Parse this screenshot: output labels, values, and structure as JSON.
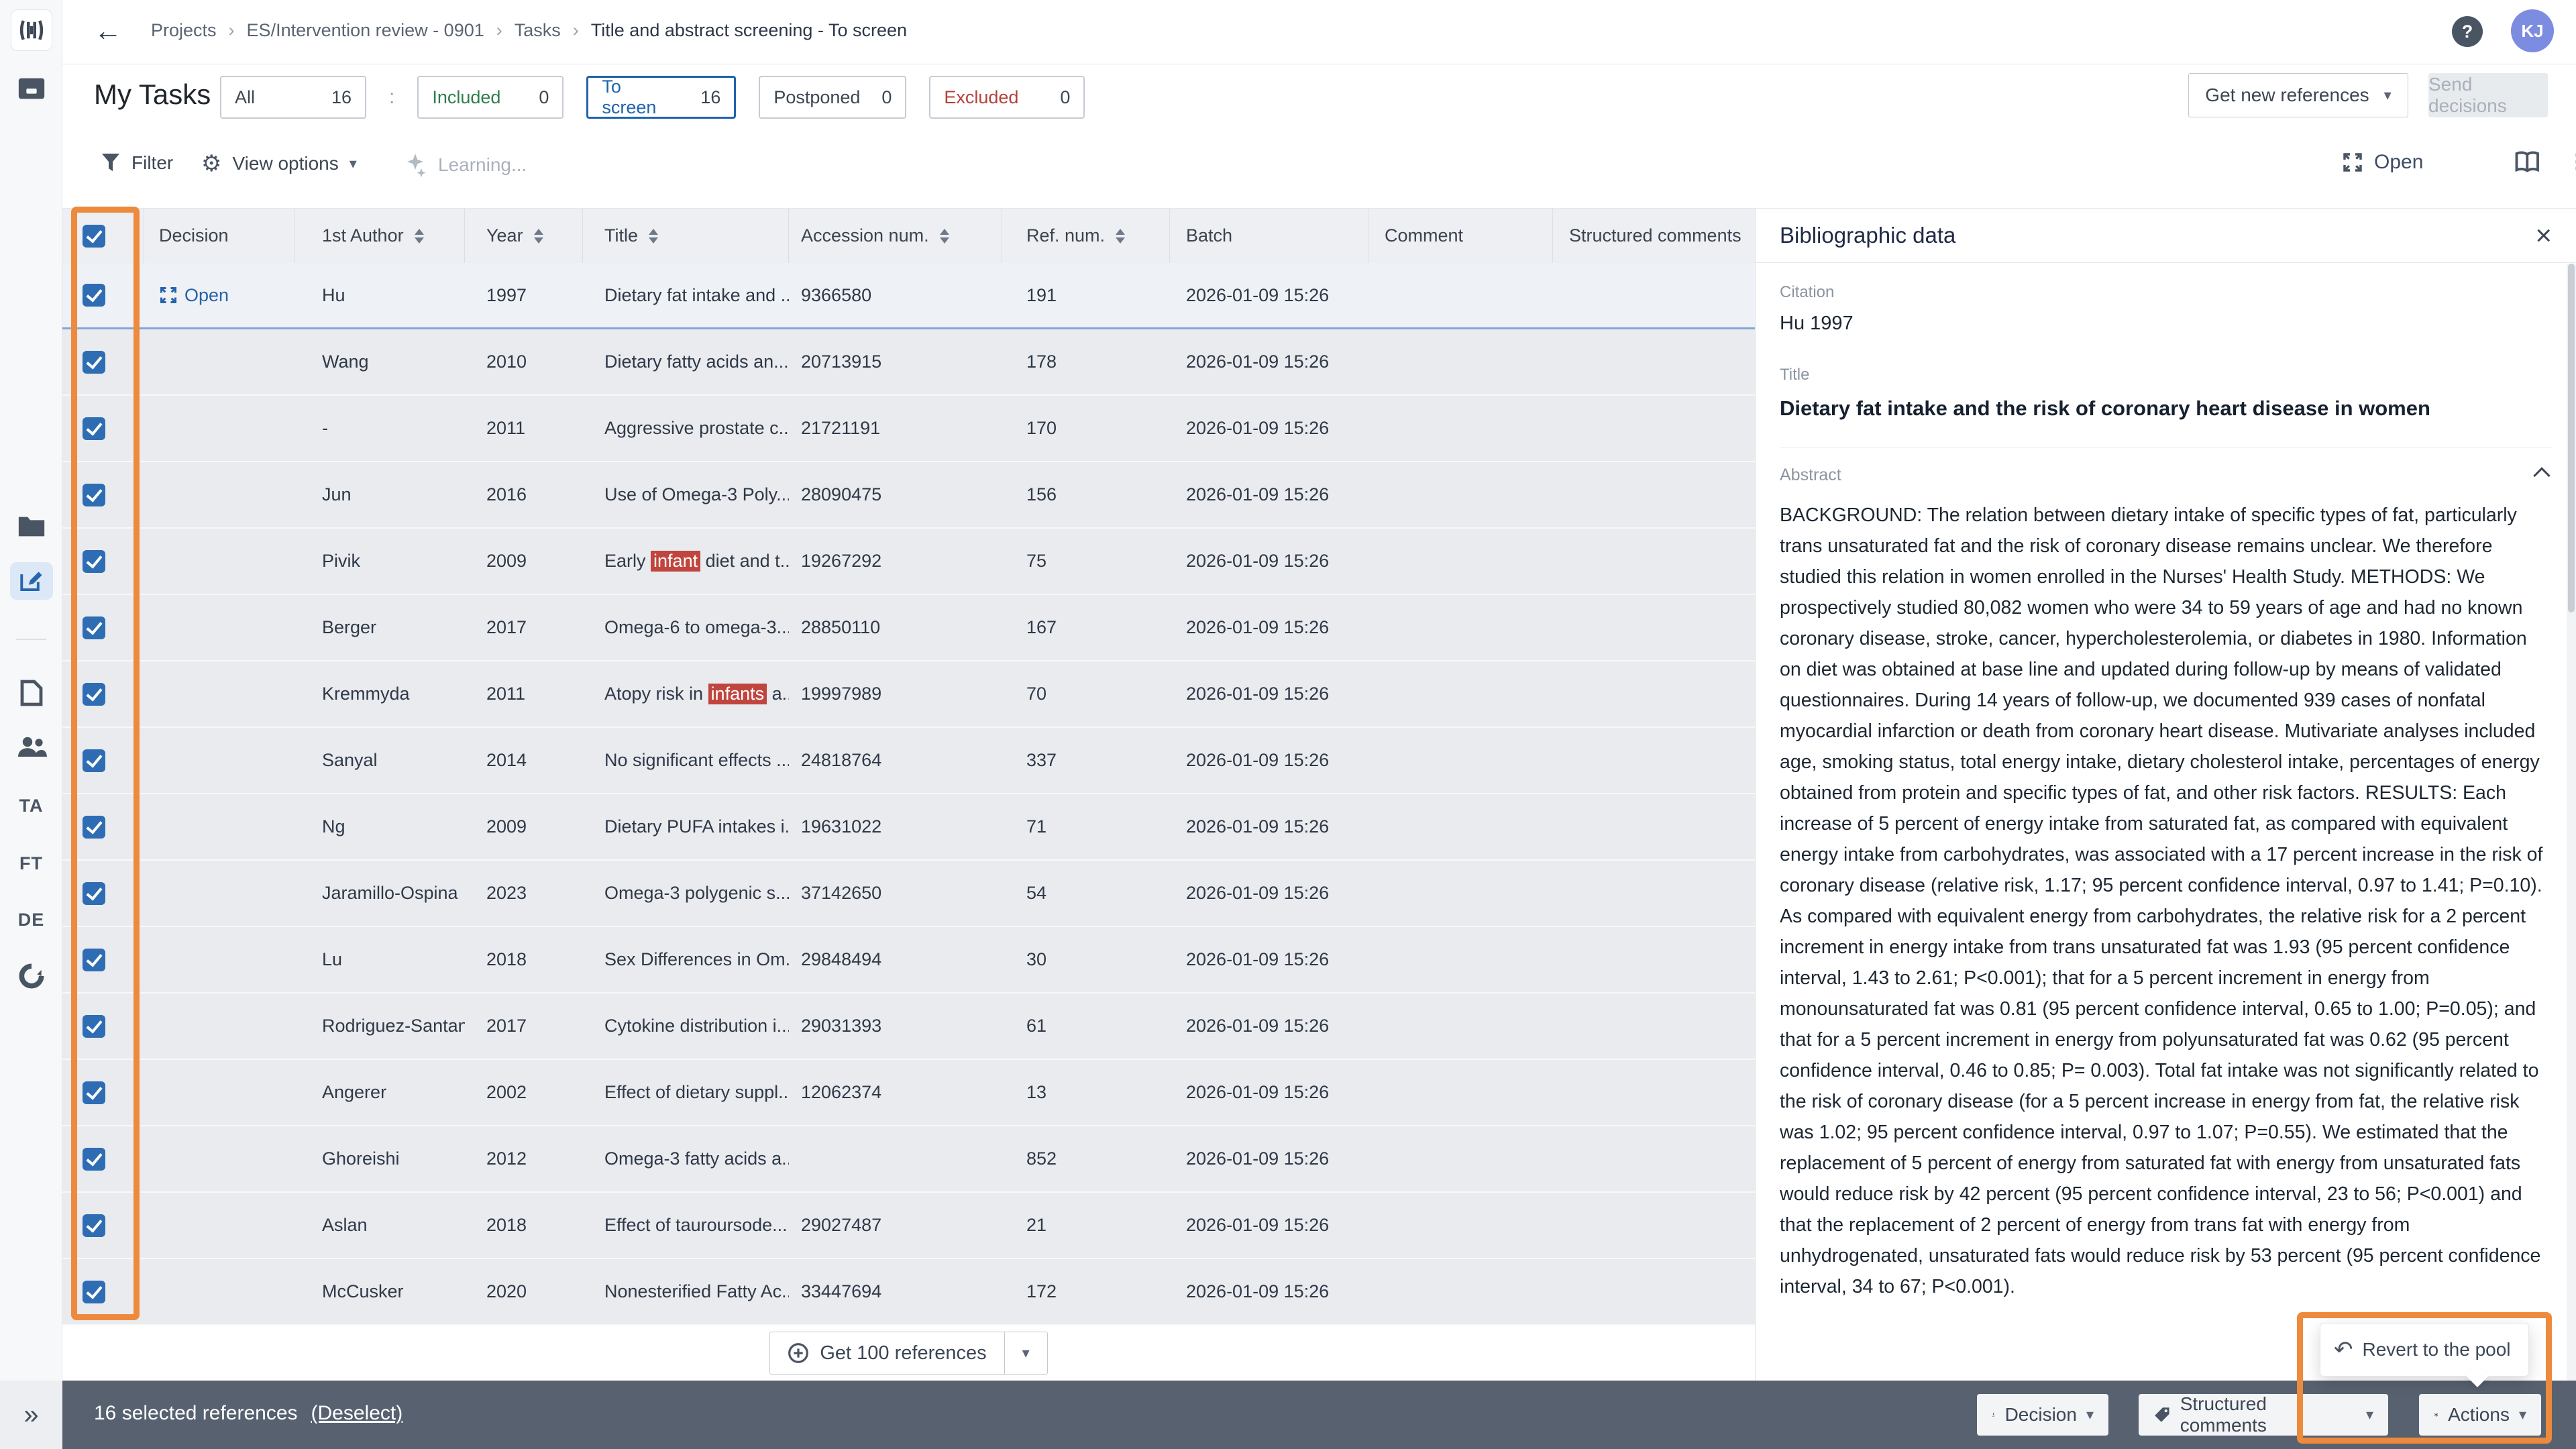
{
  "topbar": {
    "breadcrumb": [
      "Projects",
      "ES/Intervention review - 0901",
      "Tasks",
      "Title and abstract screening - To screen"
    ],
    "separator": "›",
    "back": "←",
    "help": "?",
    "avatar": "KJ"
  },
  "tasks_bar": {
    "title": "My Tasks",
    "tabs": [
      {
        "label": "All",
        "count": "16",
        "color": "#3c4653",
        "active": false
      },
      {
        "label": "Included",
        "count": "0",
        "color": "#2e7d4f",
        "active": false
      },
      {
        "label": "To screen",
        "count": "16",
        "color": "#1f63ac",
        "active": true
      },
      {
        "label": "Postponed",
        "count": "0",
        "color": "#3c4653",
        "active": false
      },
      {
        "label": "Excluded",
        "count": "0",
        "color": "#b4423a",
        "active": false
      }
    ],
    "tab_separator": ":",
    "get_new_references": "Get new references",
    "send_decisions": "Send decisions"
  },
  "toolbar": {
    "filter": "Filter",
    "view_options": "View options",
    "learning": "Learning...",
    "open": "Open"
  },
  "icons": {
    "filter": "funnel-icon",
    "view_options": "gear-icon",
    "learning": "sparkles-icon",
    "open": "expand-icon",
    "reading": "book-icon",
    "side_panel": "panel-layout-icon",
    "decision": "gavel-icon",
    "structured": "tag-icon",
    "actions": "asterisk-icon",
    "revert": "undo-icon",
    "get_refs": "plus-circle-icon",
    "help": "question-icon"
  },
  "table": {
    "columns": [
      {
        "label": "",
        "sortable": false
      },
      {
        "label": "Decision",
        "sortable": false
      },
      {
        "label": "1st Author",
        "sortable": true
      },
      {
        "label": "Year",
        "sortable": true
      },
      {
        "label": "Title",
        "sortable": true
      },
      {
        "label": "Accession num.",
        "sortable": true
      },
      {
        "label": "Ref. num.",
        "sortable": true
      },
      {
        "label": "Batch",
        "sortable": false
      },
      {
        "label": "Comment",
        "sortable": false
      },
      {
        "label": "Structured comments",
        "sortable": false
      }
    ],
    "rows": [
      {
        "decision": "Open",
        "author": "Hu",
        "year": "1997",
        "title_pre": "Dietary fat intake and ...",
        "title_hl": "",
        "title_post": "",
        "cursor": false,
        "accession": "9366580",
        "ref": "191",
        "batch": "2026-01-09 15:26"
      },
      {
        "decision": "",
        "author": "Wang",
        "year": "2010",
        "title_pre": "Dietary fatty acids an...",
        "title_hl": "",
        "title_post": "",
        "cursor": false,
        "accession": "20713915",
        "ref": "178",
        "batch": "2026-01-09 15:26"
      },
      {
        "decision": "",
        "author": "-",
        "year": "2011",
        "title_pre": "Aggressive prostate c...",
        "title_hl": "",
        "title_post": "",
        "cursor": false,
        "accession": "21721191",
        "ref": "170",
        "batch": "2026-01-09 15:26"
      },
      {
        "decision": "",
        "author": "Jun",
        "year": "2016",
        "title_pre": "Use of Omega-3 Poly...",
        "title_hl": "",
        "title_post": "",
        "cursor": false,
        "accession": "28090475",
        "ref": "156",
        "batch": "2026-01-09 15:26"
      },
      {
        "decision": "",
        "author": "Pivik",
        "year": "2009",
        "title_pre": "Early ",
        "title_hl": "infant",
        "title_post": " diet and t...",
        "cursor": false,
        "accession": "19267292",
        "ref": "75",
        "batch": "2026-01-09 15:26"
      },
      {
        "decision": "",
        "author": "Berger",
        "year": "2017",
        "title_pre": "Omega-6 to omega-3...",
        "title_hl": "",
        "title_post": "",
        "cursor": false,
        "accession": "28850110",
        "ref": "167",
        "batch": "2026-01-09 15:26"
      },
      {
        "decision": "",
        "author": "Kremmyda",
        "year": "2011",
        "title_pre": "Atopy risk in ",
        "title_hl": "infants",
        "title_post": " a...",
        "cursor": false,
        "accession": "19997989",
        "ref": "70",
        "batch": "2026-01-09 15:26"
      },
      {
        "decision": "",
        "author": "Sanyal",
        "year": "2014",
        "title_pre": "No significant effects ...",
        "title_hl": "",
        "title_post": "",
        "cursor": false,
        "accession": "24818764",
        "ref": "337",
        "batch": "2026-01-09 15:26"
      },
      {
        "decision": "",
        "author": "Ng",
        "year": "2009",
        "title_pre": "Dietary PUFA intakes i...",
        "title_hl": "",
        "title_post": "",
        "cursor": true,
        "accession": "19631022",
        "ref": "71",
        "batch": "2026-01-09 15:26"
      },
      {
        "decision": "",
        "author": "Jaramillo-Ospina",
        "year": "2023",
        "title_pre": "Omega-3 polygenic s...",
        "title_hl": "",
        "title_post": "",
        "cursor": false,
        "accession": "37142650",
        "ref": "54",
        "batch": "2026-01-09 15:26"
      },
      {
        "decision": "",
        "author": "Lu",
        "year": "2018",
        "title_pre": "Sex Differences in Om...",
        "title_hl": "",
        "title_post": "",
        "cursor": false,
        "accession": "29848494",
        "ref": "30",
        "batch": "2026-01-09 15:26"
      },
      {
        "decision": "",
        "author": "Rodriguez-Santana",
        "year": "2017",
        "title_pre": "Cytokine distribution i...",
        "title_hl": "",
        "title_post": "",
        "cursor": false,
        "accession": "29031393",
        "ref": "61",
        "batch": "2026-01-09 15:26"
      },
      {
        "decision": "",
        "author": "Angerer",
        "year": "2002",
        "title_pre": "Effect of dietary suppl...",
        "title_hl": "",
        "title_post": "",
        "cursor": false,
        "accession": "12062374",
        "ref": "13",
        "batch": "2026-01-09 15:26"
      },
      {
        "decision": "",
        "author": "Ghoreishi",
        "year": "2012",
        "title_pre": "Omega-3 fatty acids a...",
        "title_hl": "",
        "title_post": "",
        "cursor": false,
        "accession": "",
        "ref": "852",
        "batch": "2026-01-09 15:26"
      },
      {
        "decision": "",
        "author": "Aslan",
        "year": "2018",
        "title_pre": "Effect of tauroursode...",
        "title_hl": "",
        "title_post": "",
        "cursor": false,
        "accession": "29027487",
        "ref": "21",
        "batch": "2026-01-09 15:26"
      },
      {
        "decision": "",
        "author": "McCusker",
        "year": "2020",
        "title_pre": "Nonesterified Fatty Ac...",
        "title_hl": "",
        "title_post": "",
        "cursor": false,
        "accession": "33447694",
        "ref": "172",
        "batch": "2026-01-09 15:26"
      }
    ],
    "get_references": "Get 100 references"
  },
  "panel": {
    "title": "Bibliographic data",
    "close": "×",
    "citation_label": "Citation",
    "citation": "Hu 1997",
    "title_label": "Title",
    "ref_title": "Dietary fat intake and the risk of coronary heart disease in women",
    "abstract_label": "Abstract",
    "abstract": "BACKGROUND: The relation between dietary intake of specific types of fat, particularly trans unsaturated fat and the risk of coronary disease remains unclear. We therefore studied this relation in women enrolled in the Nurses' Health Study. METHODS: We prospectively studied 80,082 women who were 34 to 59 years of age and had no known coronary disease, stroke, cancer, hypercholesterolemia, or diabetes in 1980. Information on diet was obtained at base line and updated during follow-up by means of validated questionnaires. During 14 years of follow-up, we documented 939 cases of nonfatal myocardial infarction or death from coronary heart disease. Mutivariate analyses included age, smoking status, total energy intake, dietary cholesterol intake, percentages of energy obtained from protein and specific types of fat, and other risk factors. RESULTS: Each increase of 5 percent of energy intake from saturated fat, as compared with equivalent energy intake from carbohydrates, was associated with a 17 percent increase in the risk of coronary disease (relative risk, 1.17; 95 percent confidence interval, 0.97 to 1.41; P=0.10). As compared with equivalent energy from carbohydrates, the relative risk for a 2 percent increment in energy intake from trans unsaturated fat was 1.93 (95 percent confidence interval, 1.43 to 2.61; P<0.001); that for a 5 percent increment in energy from monounsaturated fat was 0.81 (95 percent confidence interval, 0.65 to 1.00; P=0.05); and that for a 5 percent increment in energy from polyunsaturated fat was 0.62 (95 percent confidence interval, 0.46 to 0.85; P= 0.003). Total fat intake was not significantly related to the risk of coronary disease (for a 5 percent increase in energy from fat, the relative risk was 1.02; 95 percent confidence interval, 0.97 to 1.07; P=0.55). We estimated that the replacement of 5 percent of energy from saturated fat with energy from unsaturated fats would reduce risk by 42 percent (95 percent confidence interval, 23 to 56; P<0.001) and that the replacement of 2 percent of energy from trans fat with energy from unhydrogenated, unsaturated fats would reduce risk by 53 percent (95 percent confidence interval, 34 to 67; P<0.001)."
  },
  "footer": {
    "expand": "»",
    "selected": "16 selected references",
    "deselect": "(Deselect)",
    "decision": "Decision",
    "structured": "Structured comments",
    "actions": "Actions",
    "revert": "Revert to the pool"
  },
  "sidebar": {
    "badges": [
      "TA",
      "FT",
      "DE"
    ],
    "icon_names": [
      "app-logo",
      "archive-tray-icon",
      "folder-icon",
      "edit-compose-icon",
      "document-icon",
      "people-icon",
      "ta-badge",
      "ft-badge",
      "de-badge",
      "sync-icon"
    ]
  },
  "colors": {
    "accent_blue": "#1f63ac",
    "green": "#2e7d4f",
    "red": "#b4423a",
    "highlight_red": "#c0453e",
    "annotation_orange": "#ee8a3c",
    "bottom_bar": "#576170",
    "row_bg": "#e9ebef",
    "header_bg": "#edeff3"
  }
}
